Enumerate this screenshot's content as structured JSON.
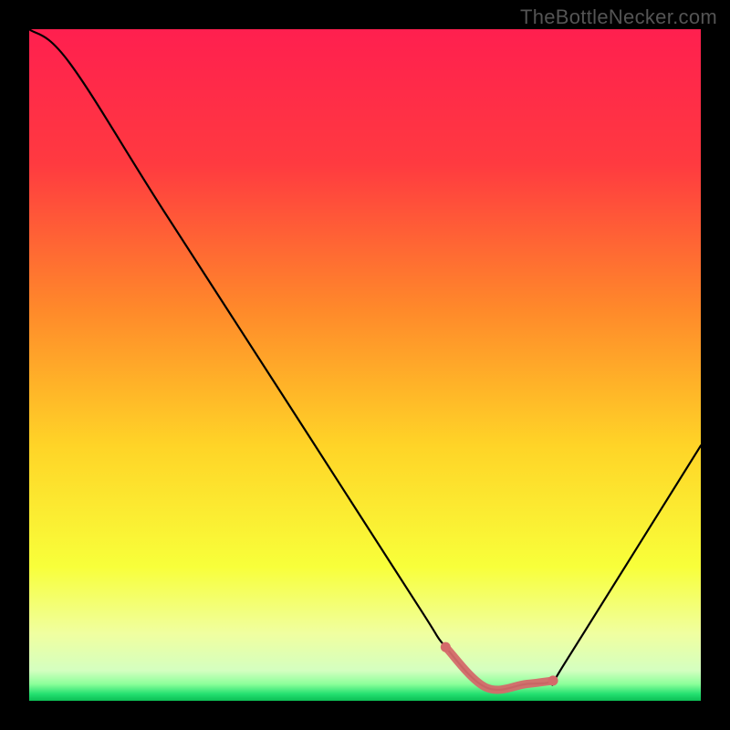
{
  "watermark": "TheBottleNecker.com",
  "chart_data": {
    "type": "line",
    "title": "",
    "xlabel": "",
    "ylabel": "",
    "xlim": [
      0,
      100
    ],
    "ylim": [
      0,
      100
    ],
    "x": [
      0,
      6,
      20,
      40,
      58,
      62,
      68,
      74,
      78,
      80,
      100
    ],
    "values": [
      100,
      95,
      73,
      42,
      14,
      8,
      2,
      2.5,
      3,
      6,
      38
    ],
    "highlight_segment": {
      "x_start": 62,
      "x_end": 78
    },
    "background": {
      "type": "vertical-gradient",
      "stops": [
        {
          "pos": 0.0,
          "color": "#ff1f4f"
        },
        {
          "pos": 0.2,
          "color": "#ff3a40"
        },
        {
          "pos": 0.42,
          "color": "#ff8a2a"
        },
        {
          "pos": 0.62,
          "color": "#ffd427"
        },
        {
          "pos": 0.8,
          "color": "#f8ff3a"
        },
        {
          "pos": 0.9,
          "color": "#f0ffa0"
        },
        {
          "pos": 0.955,
          "color": "#d4ffc0"
        },
        {
          "pos": 0.975,
          "color": "#8cff9a"
        },
        {
          "pos": 0.99,
          "color": "#23e070"
        },
        {
          "pos": 1.0,
          "color": "#0cbf55"
        }
      ]
    },
    "curve_color": "#000000",
    "highlight_color": "#d46a6a"
  }
}
